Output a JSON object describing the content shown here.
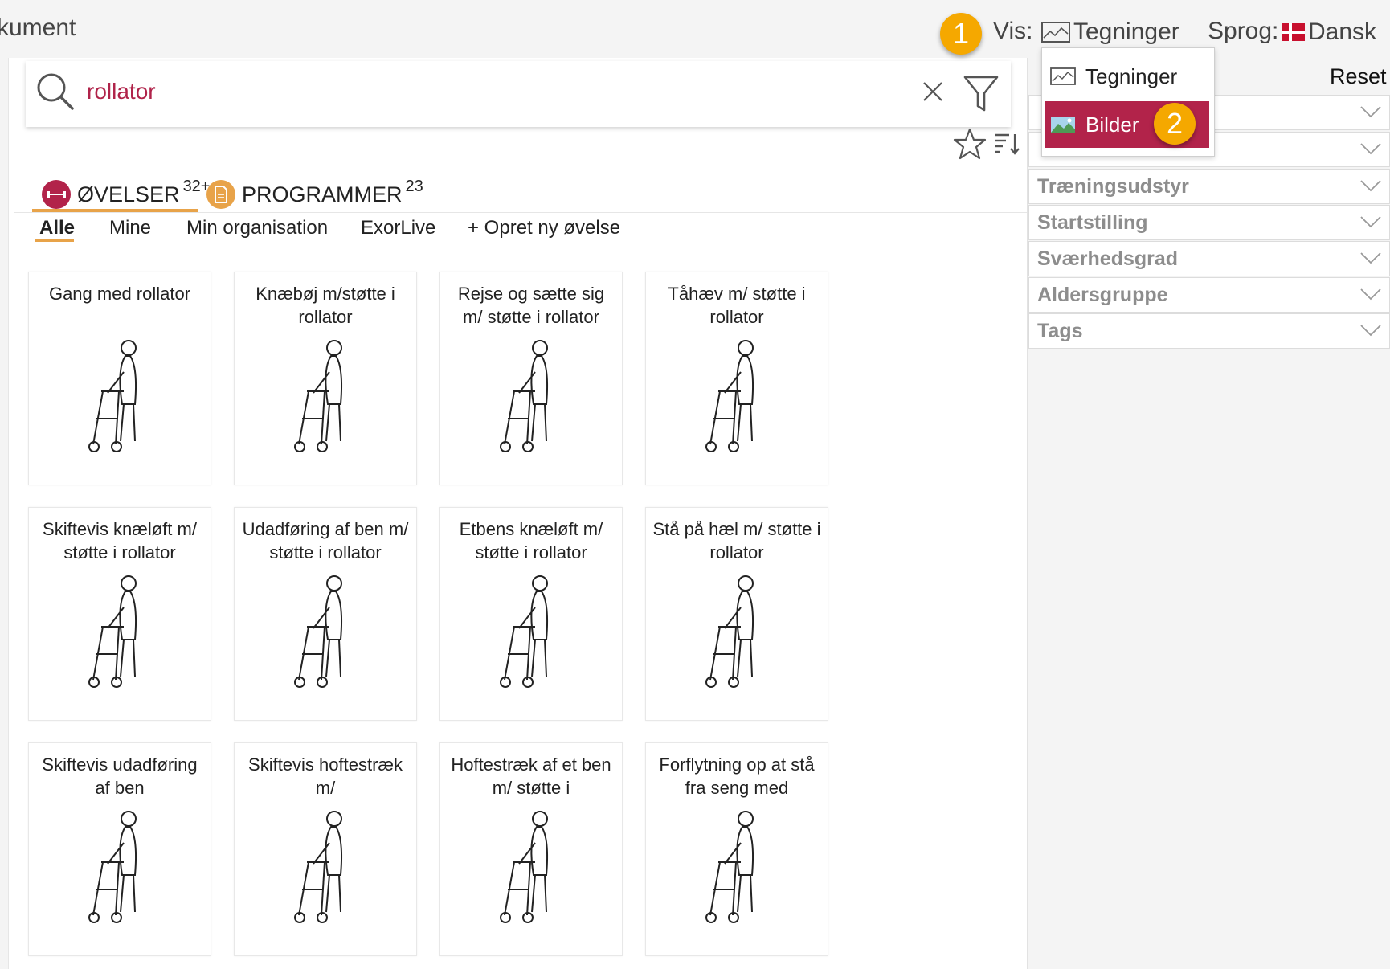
{
  "topbar": {
    "doc_title": "kument",
    "vis_label": "Vis:",
    "vis_value": "Tegninger",
    "sprog_label": "Sprog:",
    "sprog_value": "Dansk"
  },
  "callouts": [
    "1",
    "2"
  ],
  "view_dropdown": {
    "options": [
      {
        "label": "Tegninger",
        "icon": "drawing-icon"
      },
      {
        "label": "Bilder",
        "icon": "photo-icon",
        "selected": true
      }
    ]
  },
  "search": {
    "value": "rollator"
  },
  "tabs": [
    {
      "label": "ØVELSER",
      "count": "32+",
      "icon": "dumbbell-icon",
      "color": "#b2234a"
    },
    {
      "label": "PROGRAMMER",
      "count": "23",
      "icon": "document-icon",
      "color": "#e8a349"
    }
  ],
  "subnav": [
    "Alle",
    "Mine",
    "Min organisation",
    "ExorLive",
    "+ Opret ny øvelse"
  ],
  "cards": [
    {
      "title": "Gang med rollator"
    },
    {
      "title": "Knæbøj m/støtte i rollator"
    },
    {
      "title": "Rejse og sætte sig m/ støtte i rollator"
    },
    {
      "title": "Tåhæv m/ støtte i rollator"
    },
    {
      "title": "Skiftevis knæløft m/ støtte i rollator"
    },
    {
      "title": "Udadføring af ben m/ støtte i rollator"
    },
    {
      "title": "Etbens knæløft m/ støtte i rollator"
    },
    {
      "title": "Stå på hæl m/ støtte i rollator"
    },
    {
      "title": "Skiftevis udadføring af ben"
    },
    {
      "title": "Skiftevis hoftestræk m/"
    },
    {
      "title": "Hoftestræk af et ben m/ støtte i"
    },
    {
      "title": "Forflytning op at stå fra seng med"
    }
  ],
  "filters": {
    "reset": "Reset",
    "facets": [
      "Træningsudstyr",
      "Startstilling",
      "Sværhedsgrad",
      "Aldersgruppe",
      "Tags"
    ]
  },
  "colors": {
    "accent": "#b2234a",
    "badge": "#f5a800",
    "orange": "#e8a349"
  }
}
